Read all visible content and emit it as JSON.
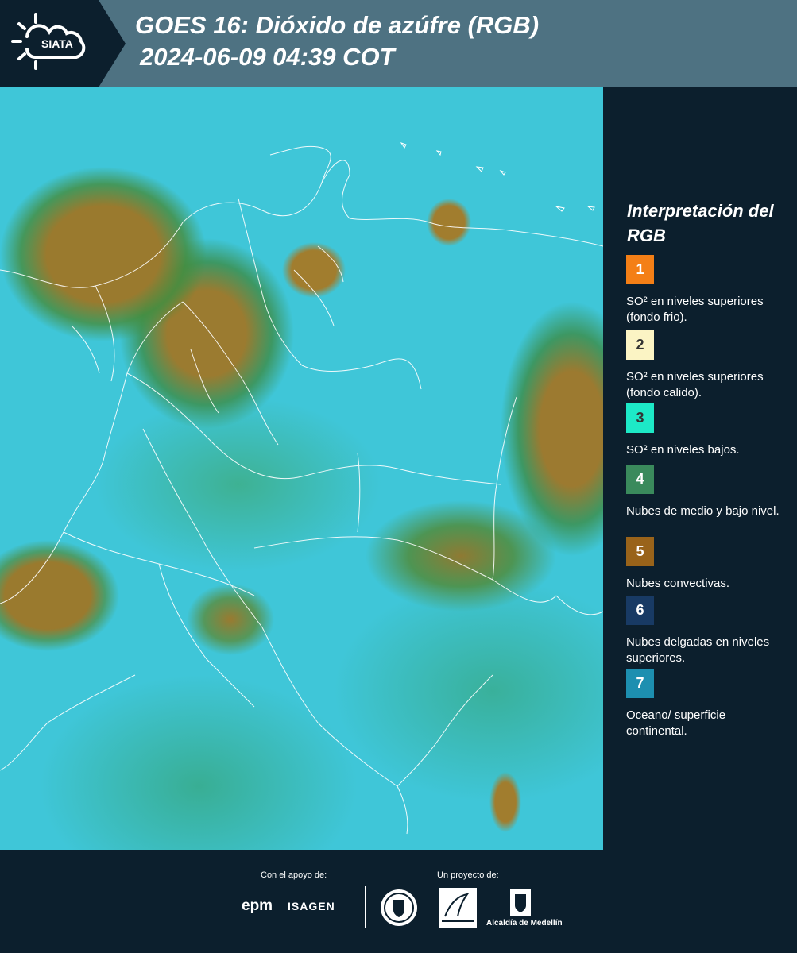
{
  "header": {
    "logo_text": "SIATA",
    "title_line1": "GOES 16: Dióxido de azúfre (RGB)",
    "title_line2": "2024-06-09 04:39 COT"
  },
  "legend": {
    "title": "Interpretación del RGB",
    "items": [
      {
        "number": "1",
        "color": "#f47f16",
        "description": "SO² en niveles superiores (fondo frio)."
      },
      {
        "number": "2",
        "color": "#fbf4c4",
        "description": "SO² en niveles superiores (fondo calido)."
      },
      {
        "number": "3",
        "color": "#1de9c7",
        "description": "SO² en niveles bajos."
      },
      {
        "number": "4",
        "color": "#3a8a5c",
        "description": "Nubes de medio y bajo nivel."
      },
      {
        "number": "5",
        "color": "#99631a",
        "description": "Nubes convectivas."
      },
      {
        "number": "6",
        "color": "#183a64",
        "description": "Nubes delgadas en niveles superiores."
      },
      {
        "number": "7",
        "color": "#1d8fb0",
        "description": "Oceano/ superficie continental."
      }
    ]
  },
  "footer": {
    "support_label": "Con el apoyo de:",
    "project_label": "Un proyecto de:",
    "sponsor1": "epm",
    "sponsor2": "ISAGEN",
    "partner_area": "Área Metropolitana Valle de Aburrá",
    "partner_alcaldia": "Alcaldía de Medellín"
  },
  "colors": {
    "header_bg": "#4e7282",
    "page_bg": "#0c1f2d",
    "map_ocean": "#3fc6d8",
    "cloud_brown": "#9a7a2e"
  }
}
